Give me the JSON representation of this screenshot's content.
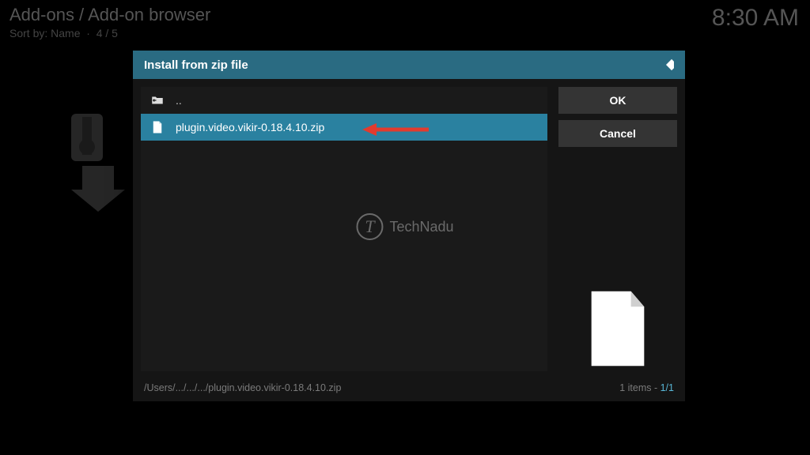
{
  "bg": {
    "title": "Add-ons / Add-on browser",
    "sort_label": "Sort by: Name",
    "sort_count": "4 / 5",
    "clock": "8:30 AM"
  },
  "dialog": {
    "title": "Install from zip file",
    "items": [
      {
        "label": ".."
      },
      {
        "label": "plugin.video.vikir-0.18.4.10.zip"
      }
    ],
    "ok": "OK",
    "cancel": "Cancel",
    "path": "/Users/.../.../.../plugin.video.vikir-0.18.4.10.zip",
    "pager_text": "1 items - ",
    "pager_count": "1/1"
  },
  "watermark": "TechNadu"
}
